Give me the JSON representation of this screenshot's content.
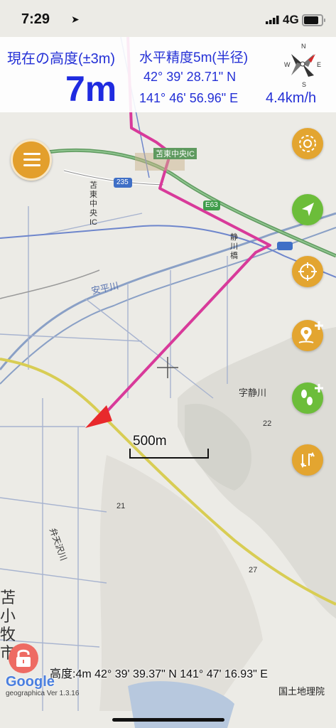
{
  "status_bar": {
    "time": "7:29",
    "network": "4G",
    "battery_level": 0.85
  },
  "header": {
    "altitude_label": "現在の高度(±3m)",
    "altitude_value": "7m",
    "accuracy_label": "水平精度5m(半径)",
    "latitude": "42° 39' 28.71\" N",
    "longitude": "141° 46' 56.96\" E",
    "speed": "4.4km/h",
    "compass_labels": {
      "n": "N",
      "e": "E",
      "s": "S",
      "w": "W"
    }
  },
  "map": {
    "labels": {
      "ic_name": "苫東中央IC",
      "route_235": "235",
      "expressway": "E63",
      "vertical_ic": "苫東中央IC",
      "bridge": "静川橋",
      "river": "安平川",
      "district": "字静川",
      "river_small": "弁天沢川",
      "elevation_22": "22",
      "elevation_21": "21",
      "elevation_27": "27",
      "route_small": "235",
      "city": "苫小牧市"
    },
    "scale_label": "500m"
  },
  "footer": {
    "position_info": "高度:4m  42° 39' 39.37\" N 141° 47' 16.93\" E",
    "google": "Google",
    "version": "geographica Ver 1.3.16",
    "attribution": "国土地理院"
  },
  "icons": {
    "menu": "list-icon",
    "compass_button": "radar-icon",
    "navigate": "navigation-arrow-icon",
    "target": "crosshair-icon",
    "add_point": "map-pin-plus-icon",
    "add_track": "footprints-plus-icon",
    "route": "route-icon",
    "lock": "lock-icon"
  },
  "colors": {
    "accent_blue": "#1f2be0",
    "button_orange": "#e3a530",
    "button_green": "#6cbd3a",
    "route_pink": "#d83a9a",
    "lock_red": "#ee6b63"
  }
}
